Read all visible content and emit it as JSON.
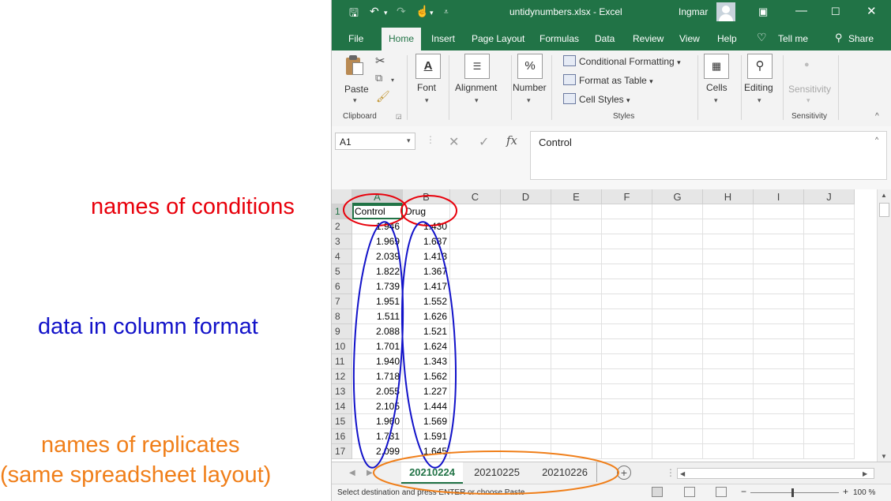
{
  "annotations": {
    "conditions": "names of conditions",
    "data_format": "data in column format",
    "replicates_line1": "names of replicates",
    "replicates_line2": "(same spreadsheet layout)",
    "colors": {
      "conditions": "#e8000b",
      "data_format": "#1212c9",
      "replicates": "#f07f1a"
    }
  },
  "window": {
    "title": "untidynumbers.xlsx  -  Excel",
    "user": "Ingmar",
    "accent_color": "#217346"
  },
  "menu": {
    "file": "File",
    "home": "Home",
    "insert": "Insert",
    "page_layout": "Page Layout",
    "formulas": "Formulas",
    "data": "Data",
    "review": "Review",
    "view": "View",
    "help": "Help",
    "tell_me": "Tell me",
    "share": "Share"
  },
  "ribbon": {
    "paste": "Paste",
    "clipboard": "Clipboard",
    "font": "Font",
    "alignment": "Alignment",
    "number": "Number",
    "conditional_formatting": "Conditional Formatting",
    "format_as_table": "Format as Table",
    "cell_styles": "Cell Styles",
    "styles": "Styles",
    "cells": "Cells",
    "editing": "Editing",
    "sensitivity": "Sensitivity",
    "sensitivity_group": "Sensitivity"
  },
  "formula_bar": {
    "name_box": "A1",
    "content": "Control",
    "fx": "fx"
  },
  "columns": [
    "A",
    "B",
    "C",
    "D",
    "E",
    "F",
    "G",
    "H",
    "I",
    "J"
  ],
  "rows": [
    "1",
    "2",
    "3",
    "4",
    "5",
    "6",
    "7",
    "8",
    "9",
    "10",
    "11",
    "12",
    "13",
    "14",
    "15",
    "16",
    "17"
  ],
  "headers": [
    "Control",
    "Drug"
  ],
  "control": [
    "1.946",
    "1.969",
    "2.039",
    "1.822",
    "1.739",
    "1.951",
    "1.511",
    "2.088",
    "1.701",
    "1.940",
    "1.718",
    "2.055",
    "2.105",
    "1.960",
    "1.731",
    "2.099"
  ],
  "drug": [
    "1.430",
    "1.687",
    "1.413",
    "1.367",
    "1.417",
    "1.552",
    "1.626",
    "1.521",
    "1.624",
    "1.343",
    "1.562",
    "1.227",
    "1.444",
    "1.569",
    "1.591",
    "1.645"
  ],
  "sheets": [
    "20210224",
    "20210225",
    "20210226"
  ],
  "active_sheet": "20210224",
  "status": {
    "message": "Select destination and press ENTER or choose Paste",
    "zoom": "100 %"
  }
}
